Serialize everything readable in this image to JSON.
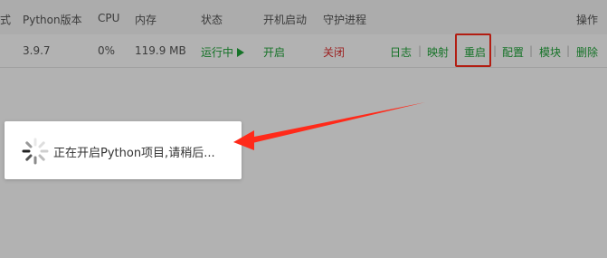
{
  "table": {
    "headers": {
      "type_partial": "式",
      "python_version": "Python版本",
      "cpu": "CPU",
      "memory": "内存",
      "status": "状态",
      "autostart": "开机启动",
      "daemon": "守护进程",
      "actions": "操作"
    },
    "row": {
      "python_version": "3.9.7",
      "cpu": "0%",
      "memory": "119.9 MB",
      "status": "运行中",
      "autostart": "开启",
      "daemon": "关闭",
      "actions": {
        "log": "日志",
        "mapping": "映射",
        "restart": "重启",
        "config": "配置",
        "module": "模块",
        "delete": "删除"
      },
      "separator": "|"
    }
  },
  "toast": {
    "message": "正在开启Python项目,请稍后..."
  },
  "colors": {
    "accent_green": "#20a53a",
    "danger_red": "#e03030",
    "annotation_red": "#ff2a1a"
  },
  "icons": {
    "status": "play-icon",
    "loading": "loading-spinner-icon",
    "annotation": "red-arrow-icon"
  }
}
